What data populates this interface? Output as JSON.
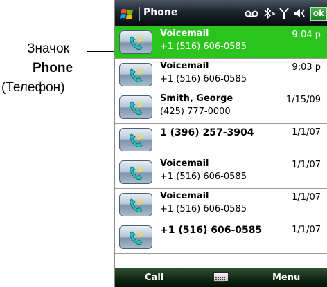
{
  "callout": {
    "line1": "Значок",
    "line2": "Phone",
    "line3": "(Телефон)"
  },
  "titlebar": {
    "title": "Phone",
    "ok_label": "ok",
    "icons": [
      "start-icon",
      "voicemail-status-icon",
      "bluetooth-icon",
      "signal-icon",
      "volume-icon"
    ]
  },
  "call_log": [
    {
      "name": "Voicemail",
      "number": "+1 (516) 606-0585",
      "time": "9:04 p",
      "selected": true
    },
    {
      "name": "Voicemail",
      "number": "+1 (516) 606-0585",
      "time": "9:03 p",
      "selected": false
    },
    {
      "name": "Smith, George",
      "number": "(425) 777-0000",
      "time": "1/15/09",
      "selected": false
    },
    {
      "name": "1 (396) 257-3904",
      "number": "",
      "time": "1/1/07",
      "selected": false
    },
    {
      "name": "Voicemail",
      "number": "+1 (516) 606-0585",
      "time": "1/1/07",
      "selected": false
    },
    {
      "name": "Voicemail",
      "number": "+1 (516) 606-0585",
      "time": "1/1/07",
      "selected": false
    },
    {
      "name": "+1 (516) 606-0585",
      "number": "",
      "time": "1/1/07",
      "selected": false
    }
  ],
  "softkeys": {
    "left": "Call",
    "right": "Menu",
    "center_icon": "keyboard-icon"
  },
  "colors": {
    "selected_row": "#2bc41d",
    "titlebar": "#0b1016",
    "softkey_bar": "#0f2812",
    "ok_button": "#2e9a31"
  }
}
